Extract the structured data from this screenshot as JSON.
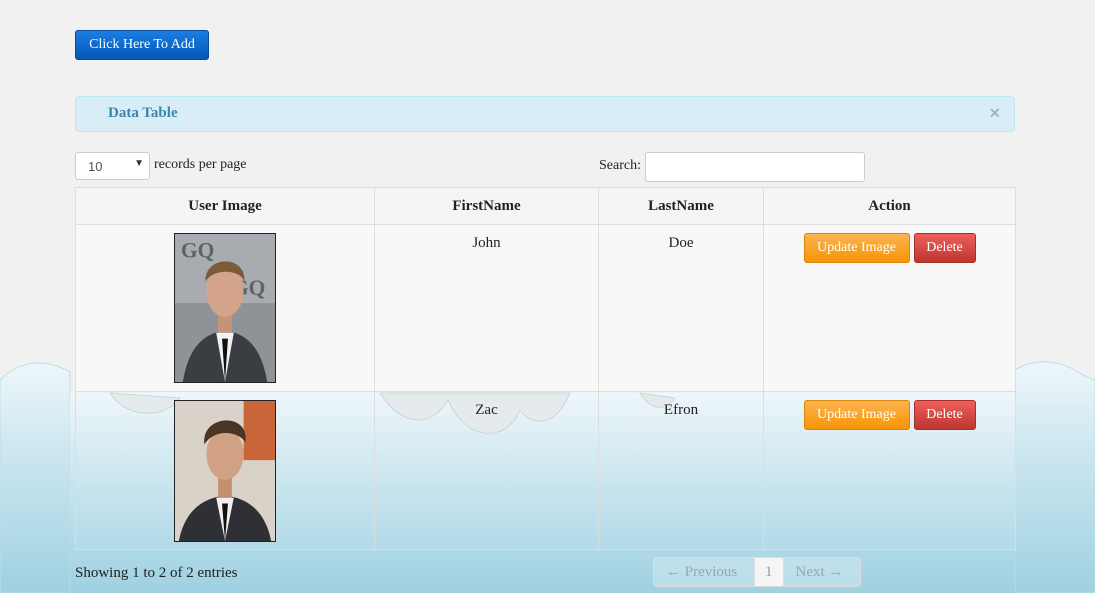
{
  "toolbar": {
    "add_label": "Click Here To Add"
  },
  "panel": {
    "title": "Data Table",
    "close_glyph": "×"
  },
  "length": {
    "value": "10",
    "suffix": "records per page"
  },
  "search": {
    "label": "Search:",
    "value": ""
  },
  "table": {
    "columns": [
      "User Image",
      "FirstName",
      "LastName",
      "Action"
    ],
    "rows": [
      {
        "first": "John",
        "last": "Doe",
        "update_label": "Update Image",
        "delete_label": "Delete"
      },
      {
        "first": "Zac",
        "last": "Efron",
        "update_label": "Update Image",
        "delete_label": "Delete"
      }
    ]
  },
  "footer": {
    "info": "Showing 1 to 2 of 2 entries",
    "prev": "← Previous",
    "page": "1",
    "next": "Next →"
  },
  "colors": {
    "primary": "#0458b8",
    "warning": "#f89406",
    "danger": "#bd362f",
    "info_bg": "#d9edf7",
    "sky": "#a6d4e2"
  }
}
